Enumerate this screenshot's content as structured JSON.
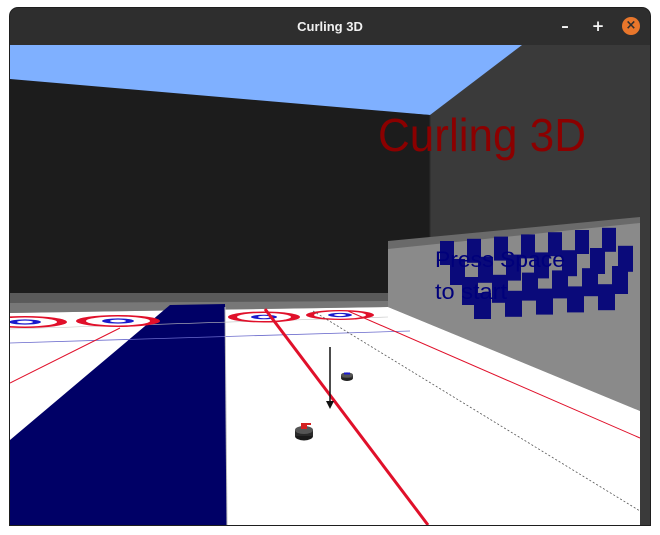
{
  "window": {
    "title": "Curling 3D",
    "buttons": {
      "minimize": "–",
      "maximize": "+",
      "close": "×"
    }
  },
  "scene": {
    "game_title": "Curling 3D",
    "prompt_line1": "Press Space",
    "prompt_line2": "to start",
    "colors": {
      "sky": "#7fb0ff",
      "wall": "#1c1c1c",
      "right_wall": "#3a3a3a",
      "stands": "#8a8a8a",
      "ice": "#ffffff",
      "rink_edge": "#000066",
      "title_text": "#8b0000",
      "prompt_text": "#00007a",
      "house_red": "#e0102a",
      "house_blue": "#1a1acc",
      "stone_red_handle": "#d42020",
      "stone_blue_handle": "#1a1acc",
      "seat": "#0a0a7a"
    }
  }
}
